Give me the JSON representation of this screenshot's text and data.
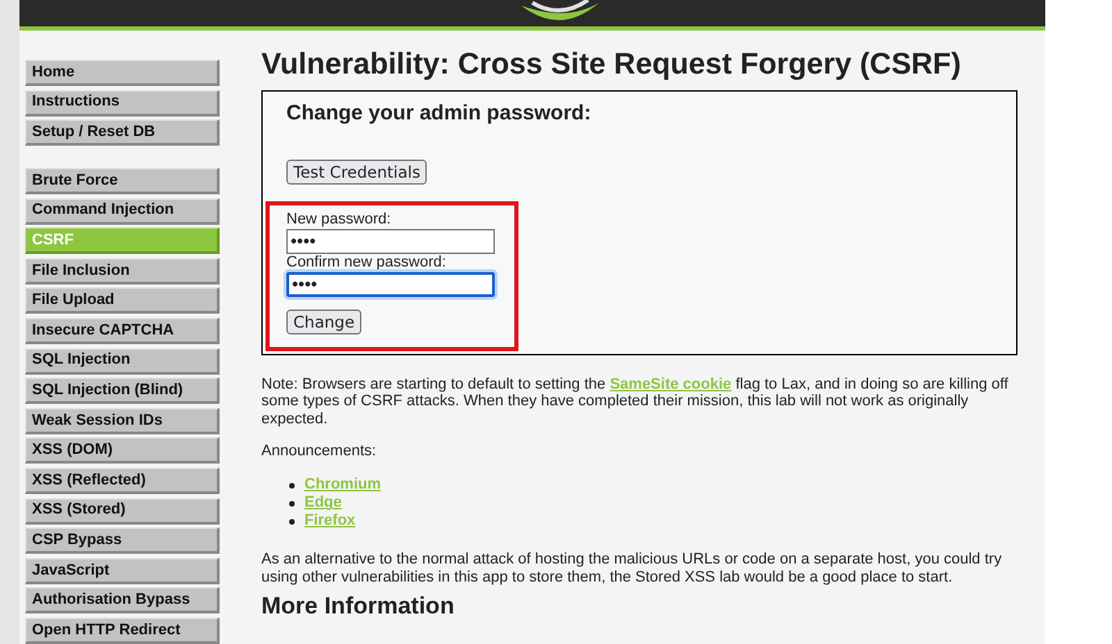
{
  "menu_groups": [
    [
      {
        "label": "Home",
        "selected": false
      },
      {
        "label": "Instructions",
        "selected": false
      },
      {
        "label": "Setup / Reset DB",
        "selected": false
      }
    ],
    [
      {
        "label": "Brute Force",
        "selected": false
      },
      {
        "label": "Command Injection",
        "selected": false
      },
      {
        "label": "CSRF",
        "selected": true
      },
      {
        "label": "File Inclusion",
        "selected": false
      },
      {
        "label": "File Upload",
        "selected": false
      },
      {
        "label": "Insecure CAPTCHA",
        "selected": false
      },
      {
        "label": "SQL Injection",
        "selected": false
      },
      {
        "label": "SQL Injection (Blind)",
        "selected": false
      },
      {
        "label": "Weak Session IDs",
        "selected": false
      },
      {
        "label": "XSS (DOM)",
        "selected": false
      },
      {
        "label": "XSS (Reflected)",
        "selected": false
      },
      {
        "label": "XSS (Stored)",
        "selected": false
      },
      {
        "label": "CSP Bypass",
        "selected": false
      },
      {
        "label": "JavaScript",
        "selected": false
      },
      {
        "label": "Authorisation Bypass",
        "selected": false
      },
      {
        "label": "Open HTTP Redirect",
        "selected": false
      }
    ]
  ],
  "title": "Vulnerability: Cross Site Request Forgery (CSRF)",
  "form": {
    "heading": "Change your admin password:",
    "test_button": "Test Credentials",
    "fields": [
      {
        "label": "New password:",
        "value": "••••",
        "focused": false
      },
      {
        "label": "Confirm new password:",
        "value": "••••",
        "focused": true
      }
    ],
    "submit_button": "Change"
  },
  "note": {
    "before": "Note: Browsers are starting to default to setting the",
    "link": "SameSite cookie",
    "after": "flag to Lax, and in doing so are killing off some types of CSRF attacks. When they have completed their mission, this lab will not work as originally expected."
  },
  "announcements_label": "Announcements:",
  "announcements": [
    "Chromium",
    "Edge",
    "Firefox"
  ],
  "alternative": "As an alternative to the normal attack of hosting the malicious URLs or code on a separate host, you could try using other vulnerabilities in this app to store them, the Stored XSS lab would be a good place to start.",
  "more_heading": "More Information"
}
